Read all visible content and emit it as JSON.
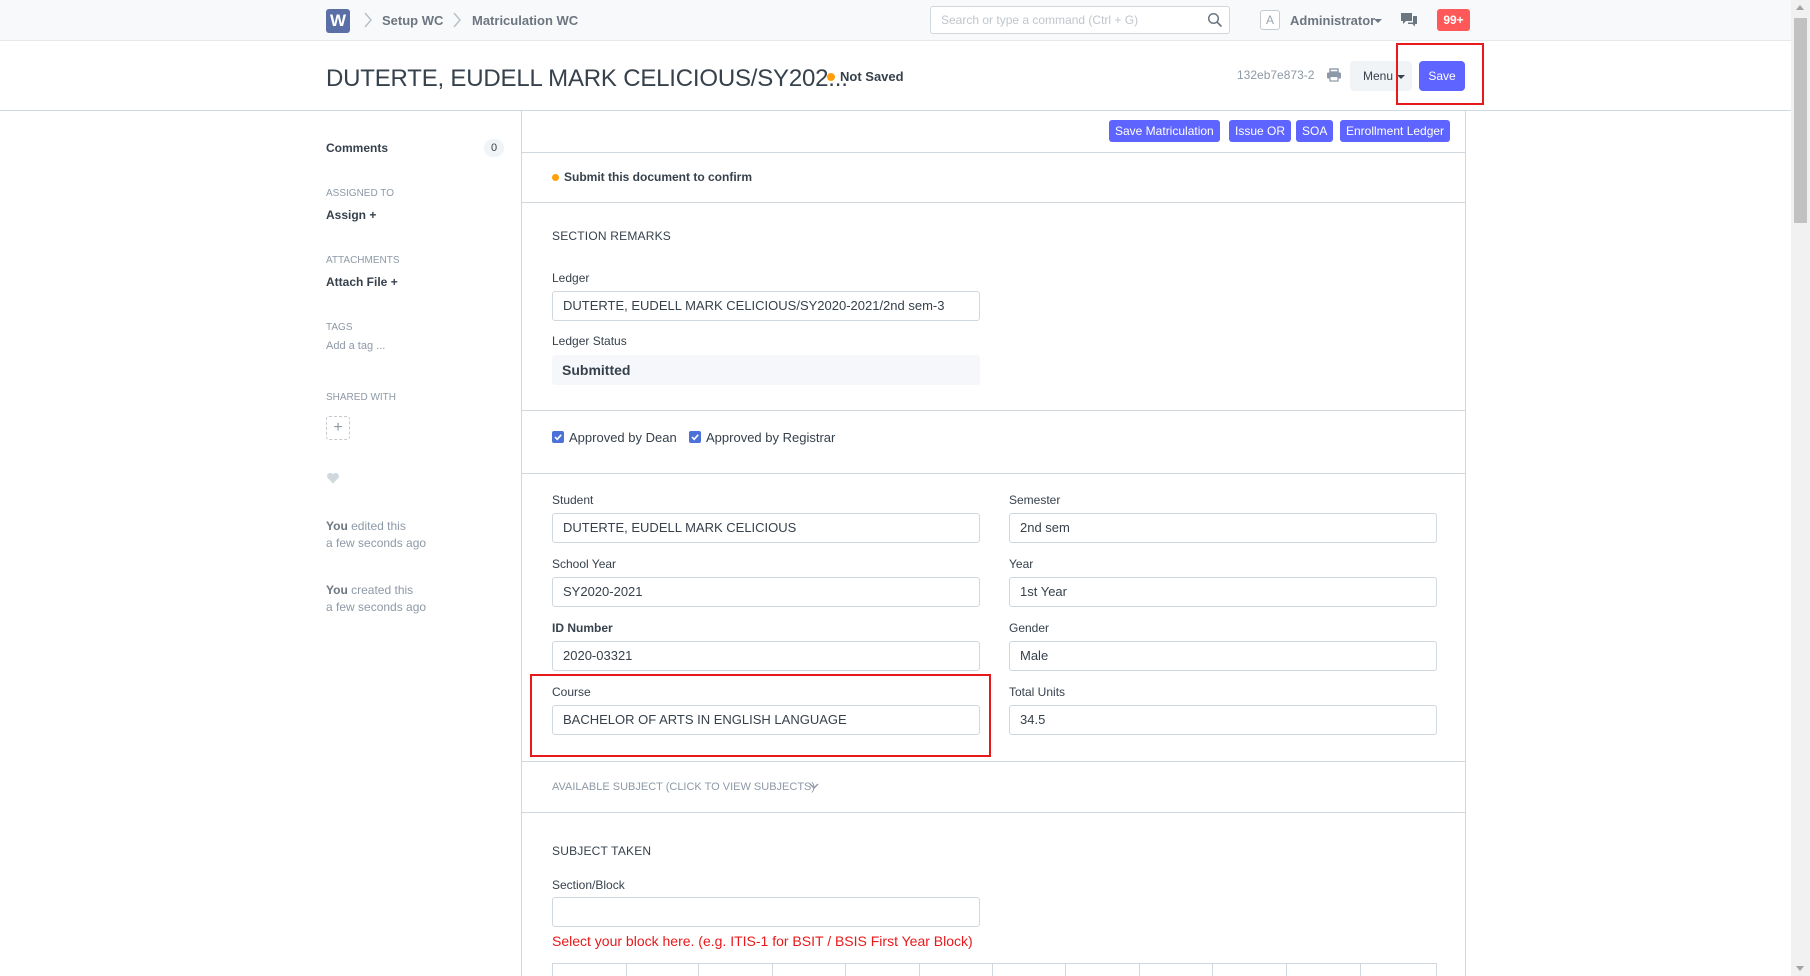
{
  "navbar": {
    "logo": "W",
    "breadcrumbs": [
      "Setup WC",
      "Matriculation WC"
    ],
    "search_placeholder": "Search or type a command (Ctrl + G)",
    "avatar_letter": "A",
    "user": "Administrator",
    "notifications": "99+"
  },
  "header": {
    "title": "DUTERTE, EUDELL MARK CELICIOUS/SY202...",
    "status": "Not Saved",
    "doc_id": "132eb7e873-2",
    "menu_label": "Menu",
    "save_label": "Save"
  },
  "sidebar": {
    "comments_label": "Comments",
    "comments_count": "0",
    "assigned_to_label": "ASSIGNED TO",
    "assign_label": "Assign",
    "attachments_label": "ATTACHMENTS",
    "attach_label": "Attach File",
    "tags_label": "TAGS",
    "add_tag_label": "Add a tag ...",
    "shared_with_label": "SHARED WITH",
    "activity": [
      {
        "who": "You",
        "what": "edited this",
        "when": "a few seconds ago"
      },
      {
        "who": "You",
        "what": "created this",
        "when": "a few seconds ago"
      }
    ]
  },
  "form": {
    "buttons": [
      "Save Matriculation",
      "Issue OR",
      "SOA",
      "Enrollment Ledger"
    ],
    "submit_msg": "Submit this document to confirm",
    "section_remarks": "SECTION REMARKS",
    "ledger_label": "Ledger",
    "ledger_value": "DUTERTE, EUDELL MARK CELICIOUS/SY2020-2021/2nd sem-3",
    "ledger_status_label": "Ledger Status",
    "ledger_status_value": "Submitted",
    "approved_dean": "Approved by Dean",
    "approved_registrar": "Approved by Registrar",
    "student_label": "Student",
    "student_value": "DUTERTE, EUDELL MARK CELICIOUS",
    "semester_label": "Semester",
    "semester_value": "2nd sem",
    "school_year_label": "School Year",
    "school_year_value": "SY2020-2021",
    "year_label": "Year",
    "year_value": "1st Year",
    "id_number_label": "ID Number",
    "id_number_value": "2020-03321",
    "gender_label": "Gender",
    "gender_value": "Male",
    "course_label": "Course",
    "course_value": "BACHELOR OF ARTS IN ENGLISH LANGUAGE",
    "total_units_label": "Total Units",
    "total_units_value": "34.5",
    "available_subject": "AVAILABLE SUBJECT (CLICK TO VIEW SUBJECTS)",
    "subject_taken": "SUBJECT TAKEN",
    "section_block_label": "Section/Block",
    "section_block_value": "",
    "help_text": "Select your block here. (e.g. ITIS-1 for BSIT / BSIS First Year Block)"
  },
  "colors": {
    "primary": "#5e64ff",
    "indicator_orange": "#ffa00a",
    "annotation_red": "#e8191a",
    "notification_red": "#ff5858"
  }
}
